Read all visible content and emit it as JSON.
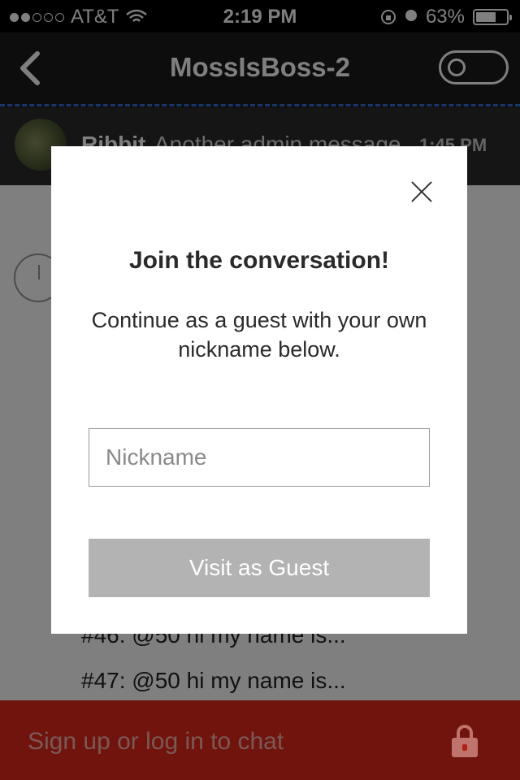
{
  "status_bar": {
    "carrier": "AT&T",
    "time": "2:19 PM",
    "battery": "63%"
  },
  "nav": {
    "title": "MossIsBoss-2"
  },
  "pinned": {
    "user": "Ribbit",
    "message": "Another admin message",
    "time": "1:45 PM"
  },
  "chat": {
    "lines": [
      "#46: @50 hi my name is...",
      "#47: @50 hi my name is..."
    ]
  },
  "bottom_bar": {
    "label": "Sign up or log in to chat"
  },
  "modal": {
    "title": "Join the conversation!",
    "text": "Continue as a guest with your own nickname below.",
    "nickname_placeholder": "Nickname",
    "nickname_value": "",
    "button_label": "Visit as Guest"
  },
  "colors": {
    "accent_red": "#e0281a",
    "dashed_blue": "#2f6fd1",
    "button_gray": "#b3b3b3"
  }
}
